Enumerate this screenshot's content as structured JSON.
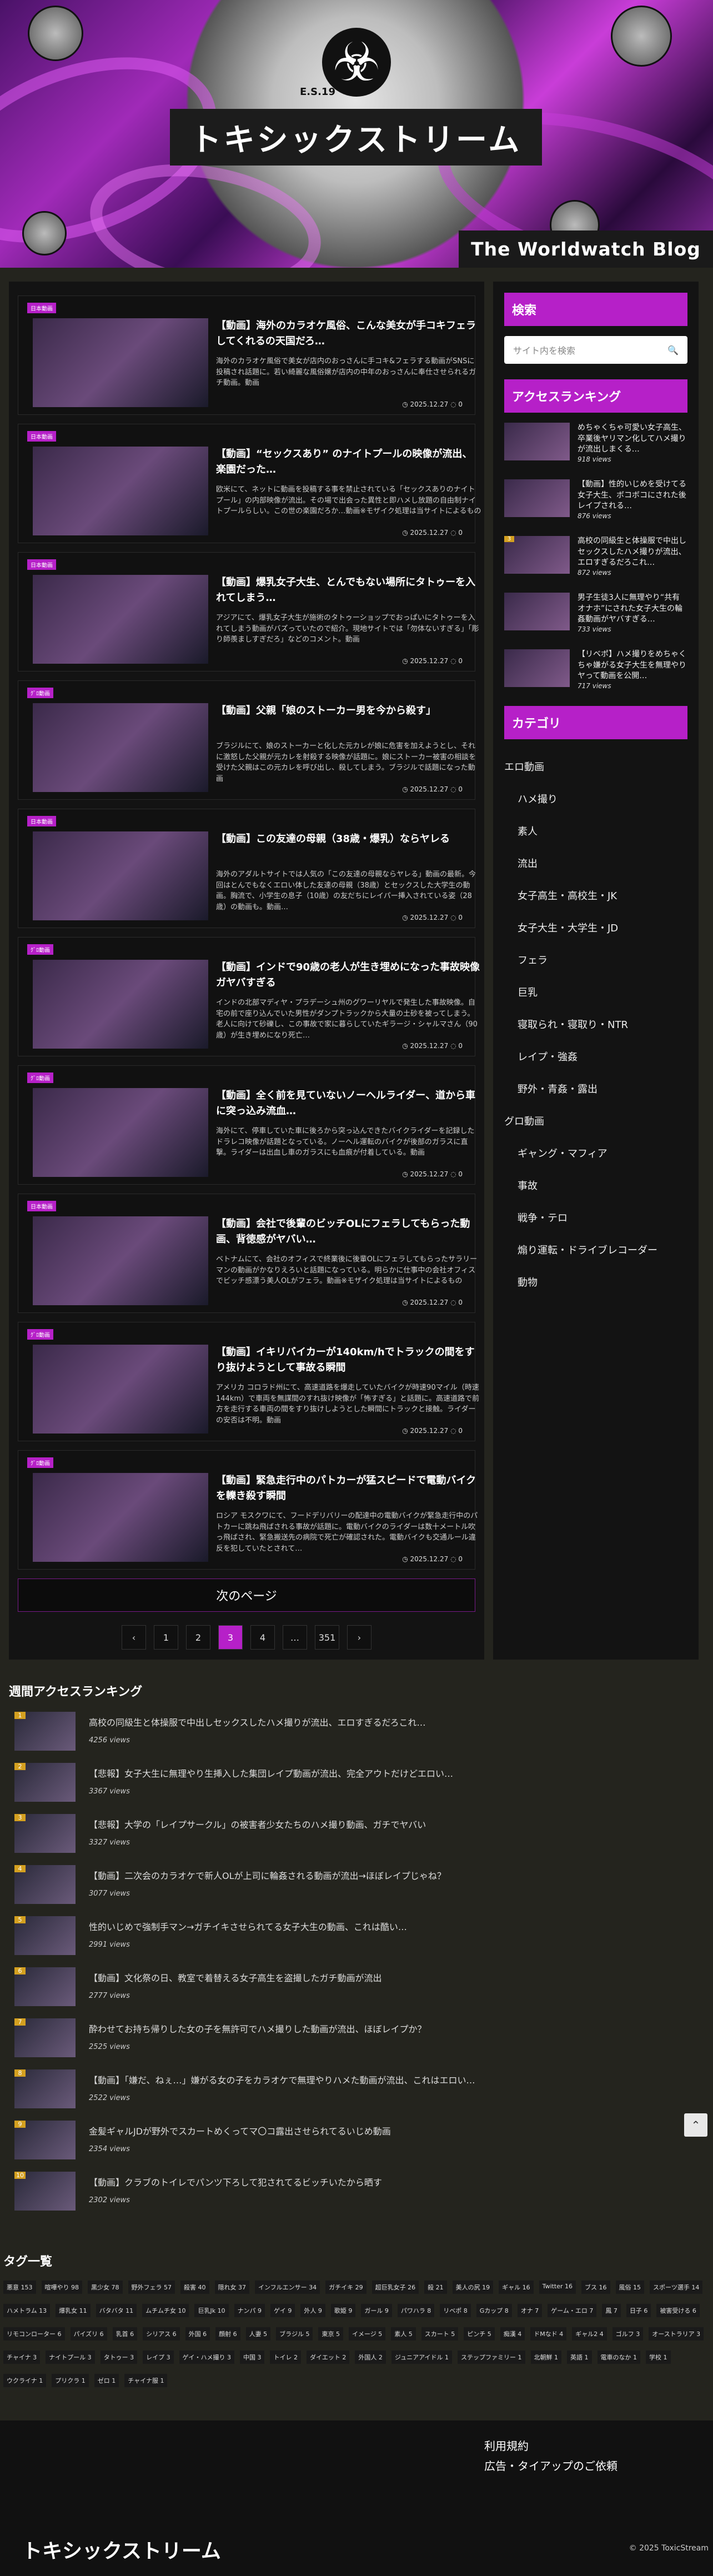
{
  "site": {
    "title": "トキシックストリーム",
    "subtitle": "The Worldwatch Blog",
    "emblem_text": "E.S.19"
  },
  "posts": [
    {
      "badge": "日本動画",
      "title": "【動画】海外のカラオケ風俗、こんな美女が手コキフェラしてくれるの天国だろ…",
      "excerpt": "海外のカラオケ風俗で美女が店内のおっさんに手コキ&フェラする動画がSNSに投稿され話題に。若い綺麗な風俗嬢が店内の中年のおっさんに奉仕させられるガチ動画。動画",
      "date": "2025.12.27",
      "comments": "0"
    },
    {
      "badge": "日本動画",
      "title": "【動画】“セックスあり” のナイトプールの映像が流出、楽園だった…",
      "excerpt": "欧米にて、ネットに動画を投稿する事を禁止されている「セックスありのナイトプール」の内部映像が流出。その場で出会った異性と即ハメし放題の自由制ナイトプールらしい。この世の楽園だろか…動画※モザイク処理は当サイトによるもの",
      "date": "2025.12.27",
      "comments": "0"
    },
    {
      "badge": "日本動画",
      "title": "【動画】爆乳女子大生、とんでもない場所にタトゥーを入れてしまう…",
      "excerpt": "アジアにて、爆乳女子大生が施術のタトゥーショップでおっぱいにタトゥーを入れてしまう動画がバズっていたので紹介。現地サイトでは「勿体ないすぎる」「彫り師羨ましすぎだろ」などのコメント。動画",
      "date": "2025.12.27",
      "comments": "0"
    },
    {
      "badge": "ｸﾞﾛ動画",
      "title": "【動画】父親「娘のストーカー男を今から殺す」",
      "excerpt": "ブラジルにて、娘のストーカーと化した元カレが娘に危害を加えようとし、それに激怒した父親が元カレを射殺する映像が話題に。娘にストーカー被害の相談を受けた父親はこの元カレを呼び出し、殺してしまう。ブラジルで話題になった動画",
      "date": "2025.12.27",
      "comments": "0"
    },
    {
      "badge": "日本動画",
      "title": "【動画】この友達の母親（38歳・爆乳）ならヤレる",
      "excerpt": "海外のアダルトサイトでは人気の「この友達の母親ならヤレる」動画の最新。今回はとんでもなくエロい体した友達の母親（38歳）とセックスした大学生の動画。胸流で、小学生の息子（10歳）の友だちにレイパー挿入されている姿（28歳）の動画も。動画…",
      "date": "2025.12.27",
      "comments": "0"
    },
    {
      "badge": "ｸﾞﾛ動画",
      "title": "【動画】インドで90歳の老人が生き埋めになった事故映像ガヤバすぎる",
      "excerpt": "インドの北部マディヤ・プラデーシュ州のグワーリヤルで発生した事故映像。自宅の前で座り込んでいた男性がダンプトラックから大量の土砂を被ってしまう。老人に向けて砂礫し、この事故で家に暮らしていたギラージ・シャルマさん（90歳）が生き埋めになり死亡…",
      "date": "2025.12.27",
      "comments": "0"
    },
    {
      "badge": "ｸﾞﾛ動画",
      "title": "【動画】全く前を見ていないノーヘルライダー、道から車に突っ込み流血…",
      "excerpt": "海外にて、停車していた車に後ろから突っ込んできたバイクライダーを記録したドラレコ映像が話題となっている。ノーヘル運転のバイクが後部のガラスに直撃。ライダーは出血し車のガラスにも血痕が付着している。動画",
      "date": "2025.12.27",
      "comments": "0"
    },
    {
      "badge": "日本動画",
      "title": "【動画】会社で後輩のビッチOLにフェラしてもらった動画、背徳感がヤバい…",
      "excerpt": "ベトナムにて、会社のオフィスで終業後に後輩OLにフェラしてもらったサラリーマンの動画がかなりえろいと話題になっている。明らかに仕事中の会社オフィスでビッチ感漂う美人OLがフェラ。動画※モザイク処理は当サイトによるもの",
      "date": "2025.12.27",
      "comments": "0"
    },
    {
      "badge": "ｸﾞﾛ動画",
      "title": "【動画】イキリバイカーが140km/hでトラックの間をすり抜けようとして事故る瞬間",
      "excerpt": "アメリカ コロラド州にて、高速道路を爆走していたバイクが時速90マイル（時速144km）で車両を無謀間のすれ抜け映像が「怖すぎる」と話題に。高速道路で前方を走行する車両の間をすり抜けしようとした瞬間にトラックと接触。ライダーの安否は不明。動画",
      "date": "2025.12.27",
      "comments": "0"
    },
    {
      "badge": "ｸﾞﾛ動画",
      "title": "【動画】緊急走行中のパトカーが猛スピードで電動バイクを轢き殺す瞬間",
      "excerpt": "ロシア モスクワにて、フードデリバリーの配達中の電動バイクが緊急走行中のパトカーに跳ね飛ばされる事故が話題に。電動バイクのライダーは数十メートル吹っ飛ばされ、緊急搬送先の病院で死亡が確認された。電動バイクも交通ルール違反を犯していたとされて…",
      "date": "2025.12.27",
      "comments": "0"
    }
  ],
  "next_page_label": "次のページ",
  "pagination": [
    "‹",
    "1",
    "2",
    "3",
    "4",
    "…",
    "351",
    "›"
  ],
  "pagination_current": "3",
  "sidebar": {
    "search_heading": "検索",
    "search_placeholder": "サイト内を検索",
    "ranking_heading": "アクセスランキング",
    "ranking": [
      {
        "title": "めちゃくちゃ可愛い女子高生、卒業後ヤリマン化してハメ撮りが流出しまくる…",
        "views": "918 views"
      },
      {
        "title": "【動画】性的いじめを受けてる女子大生、ボコボコにされた後レイプされる…",
        "views": "876 views"
      },
      {
        "title": "高校の同級生と体操服で中出しセックスしたハメ撮りが流出、エロすぎるだろこれ…",
        "views": "872 views"
      },
      {
        "title": "男子生徒3人に無理やり“共有オナホ”にされた女子大生の輪姦動画がヤバすぎる…",
        "views": "733 views"
      },
      {
        "title": "【リベポ】ハメ撮りをめちゃくちゃ嫌がる女子大生を無理やりヤって動画を公開…",
        "views": "717 views"
      }
    ],
    "category_heading": "カテゴリ",
    "categories": [
      {
        "label": "エロ動画",
        "sub": false
      },
      {
        "label": "ハメ撮り",
        "sub": true
      },
      {
        "label": "素人",
        "sub": true
      },
      {
        "label": "流出",
        "sub": true
      },
      {
        "label": "女子高生・高校生・JK",
        "sub": true
      },
      {
        "label": "女子大生・大学生・JD",
        "sub": true
      },
      {
        "label": "フェラ",
        "sub": true
      },
      {
        "label": "巨乳",
        "sub": true
      },
      {
        "label": "寝取られ・寝取り・NTR",
        "sub": true
      },
      {
        "label": "レイプ・強姦",
        "sub": true
      },
      {
        "label": "野外・青姦・露出",
        "sub": true
      },
      {
        "label": "グロ動画",
        "sub": false
      },
      {
        "label": "ギャング・マフィア",
        "sub": true
      },
      {
        "label": "事故",
        "sub": true
      },
      {
        "label": "戦争・テロ",
        "sub": true
      },
      {
        "label": "煽り運転・ドライブレコーダー",
        "sub": true
      },
      {
        "label": "動物",
        "sub": true
      }
    ]
  },
  "weekly": {
    "heading": "週間アクセスランキング",
    "items": [
      {
        "title": "高校の同級生と体操服で中出しセックスしたハメ撮りが流出、エロすぎるだろこれ…",
        "views": "4256 views"
      },
      {
        "title": "【悲報】女子大生に無理やり生挿入した集団レイプ動画が流出、完全アウトだけどエロい…",
        "views": "3367 views"
      },
      {
        "title": "【悲報】大学の「レイプサークル」の被害者少女たちのハメ撮り動画、ガチでヤバい",
        "views": "3327 views"
      },
      {
        "title": "【動画】二次会のカラオケで新人OLが上司に輪姦される動画が流出→ほぼレイプじゃね？",
        "views": "3077 views"
      },
      {
        "title": "性的いじめで強制手マン→ガチイキさせられてる女子大生の動画、これは酷い…",
        "views": "2991 views"
      },
      {
        "title": "【動画】文化祭の日、教室で着替える女子高生を盗撮したガチ動画が流出",
        "views": "2777 views"
      },
      {
        "title": "酔わせてお持ち帰りした女の子を無許可でハメ撮りした動画が流出、ほぼレイプか？",
        "views": "2525 views"
      },
      {
        "title": "【動画】「嫌だ、ねぇ…」嫌がる女の子をカラオケで無理やりハメた動画が流出、これはエロい…",
        "views": "2522 views"
      },
      {
        "title": "金髪ギャルJDが野外でスカートめくってマ〇コ露出させられてるいじめ動画",
        "views": "2354 views"
      },
      {
        "title": "【動画】クラブのトイレでパンツ下ろして犯されてるビッチいたから晒す",
        "views": "2302 views"
      }
    ]
  },
  "tags_heading": "タグ一覧",
  "tags": [
    "悪意 153",
    "喧嘩やり 98",
    "黒少女 78",
    "野外フェラ 57",
    "殺害 40",
    "隠れ女 37",
    "インフルエンサー 34",
    "ガチイキ 29",
    "超巨乳女子 26",
    "殺 21",
    "美人の尻 19",
    "ギャル 16",
    "Twitter 16",
    "ブス 16",
    "風俗 15",
    "スポーツ選手 14",
    "ハメトラム 13",
    "爆乳女 11",
    "バタバタ 11",
    "ムチムチ女 10",
    "巨乳Jk 10",
    "ナンパ 9",
    "ゲイ 9",
    "外人 9",
    "歌姫 9",
    "ガール 9",
    "パワハラ 8",
    "リベポ 8",
    "Gカップ 8",
    "オナ 7",
    "ゲーム・エロ 7",
    "鳳 7",
    "日子 6",
    "被害受ける 6",
    "リモコンローター 6",
    "パイズリ 6",
    "乳首 6",
    "シリアス 6",
    "外国 6",
    "顔射 6",
    "人妻 5",
    "ブラジル 5",
    "東京 5",
    "イメージ 5",
    "素人 5",
    "スカート 5",
    "ピンチ 5",
    "痴漢 4",
    "ドMなド 4",
    "ギャル2 4",
    "ゴルフ 3",
    "オーストラリア 3",
    "チャイナ 3",
    "ナイトプール 3",
    "タトゥー 3",
    "レイプ 3",
    "ゲイ・ハメ撮り 3",
    "中国 3",
    "トイレ 2",
    "ダイエット 2",
    "外国人 2",
    "ジュニアアイドル 1",
    "ステップファミリー 1",
    "北朝鮮 1",
    "英語 1",
    "電車のなか 1",
    "学校 1",
    "ウクライナ 1",
    "プリクラ 1",
    "ゼロ 1",
    "チャイナ服 1"
  ],
  "footer": {
    "links": [
      "利用規約",
      "広告・タイアップのご依頼"
    ],
    "title": "トキシックストリーム",
    "copyright": "© 2025 ToxicStream"
  },
  "colors": {
    "accent": "#b620c8",
    "background": "#24241e",
    "panel": "#131313",
    "rank_badge": "#d4a020"
  }
}
